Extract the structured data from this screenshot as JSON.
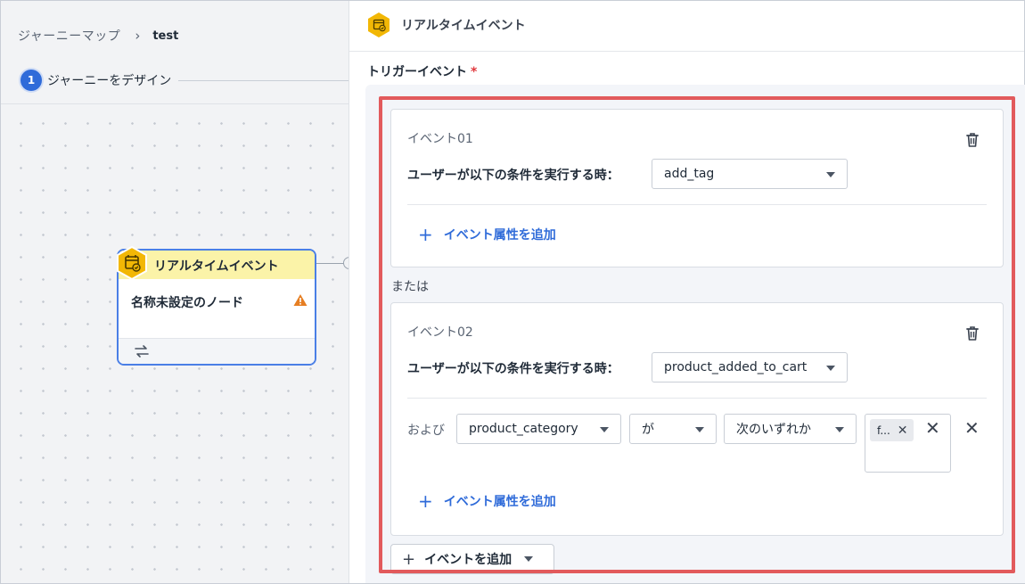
{
  "breadcrumb": {
    "root": "ジャーニーマップ",
    "separator": "›",
    "current": "test"
  },
  "stepper": {
    "number": "1",
    "label": "ジャーニーをデザイン"
  },
  "node": {
    "type_label": "リアルタイムイベント",
    "name": "名称未設定のノード",
    "header_color": "#fbf3a8",
    "border_color": "#4a7fe6",
    "warning_icon": "warning-icon",
    "footer_icon": "swap-icon"
  },
  "panel": {
    "title": "リアルタイムイベント",
    "icon": "calendar-check-icon",
    "trigger_label": "トリガーイベント",
    "required_mark": "*"
  },
  "events": [
    {
      "title": "イベント01",
      "condition_label": "ユーザーが以下の条件を実行する時：",
      "event_value": "add_tag",
      "add_attribute_label": "イベント属性を追加"
    },
    {
      "title": "イベント02",
      "condition_label": "ユーザーが以下の条件を実行する時：",
      "event_value": "product_added_to_cart",
      "filter": {
        "and_label": "および",
        "attribute": "product_category",
        "particle": "が",
        "operator": "次のいずれか",
        "tag": "f..."
      },
      "add_attribute_label": "イベント属性を追加"
    }
  ],
  "or_label": "または",
  "add_event_label": "イベントを追加",
  "colors": {
    "accent": "#2f6bd9",
    "highlight": "#e25a5c",
    "required": "#e0393e",
    "warning": "#e67e22",
    "icon_yellow": "#f2b705"
  }
}
